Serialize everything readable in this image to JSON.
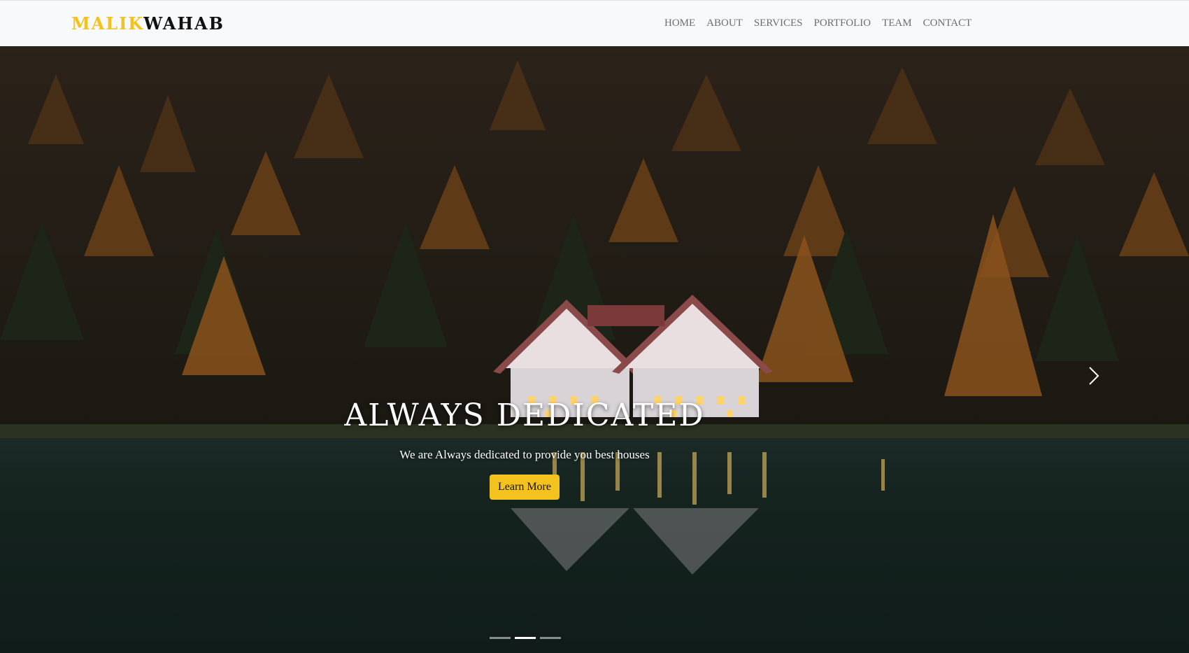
{
  "brand": {
    "part1": "MALIK",
    "part2": "WAHAB",
    "accent_color": "#f4c21f"
  },
  "nav": {
    "items": [
      {
        "label": "HOME"
      },
      {
        "label": "ABOUT"
      },
      {
        "label": "SERVICES"
      },
      {
        "label": "PORTFOLIO"
      },
      {
        "label": "TEAM"
      },
      {
        "label": "CONTACT"
      }
    ]
  },
  "hero": {
    "title": "ALWAYS DEDICATED",
    "subtitle": "We are Always dedicated to provide you best houses",
    "button_label": "Learn More",
    "next_icon": "chevron-right-icon",
    "slides_count": 3,
    "active_slide": 2
  }
}
